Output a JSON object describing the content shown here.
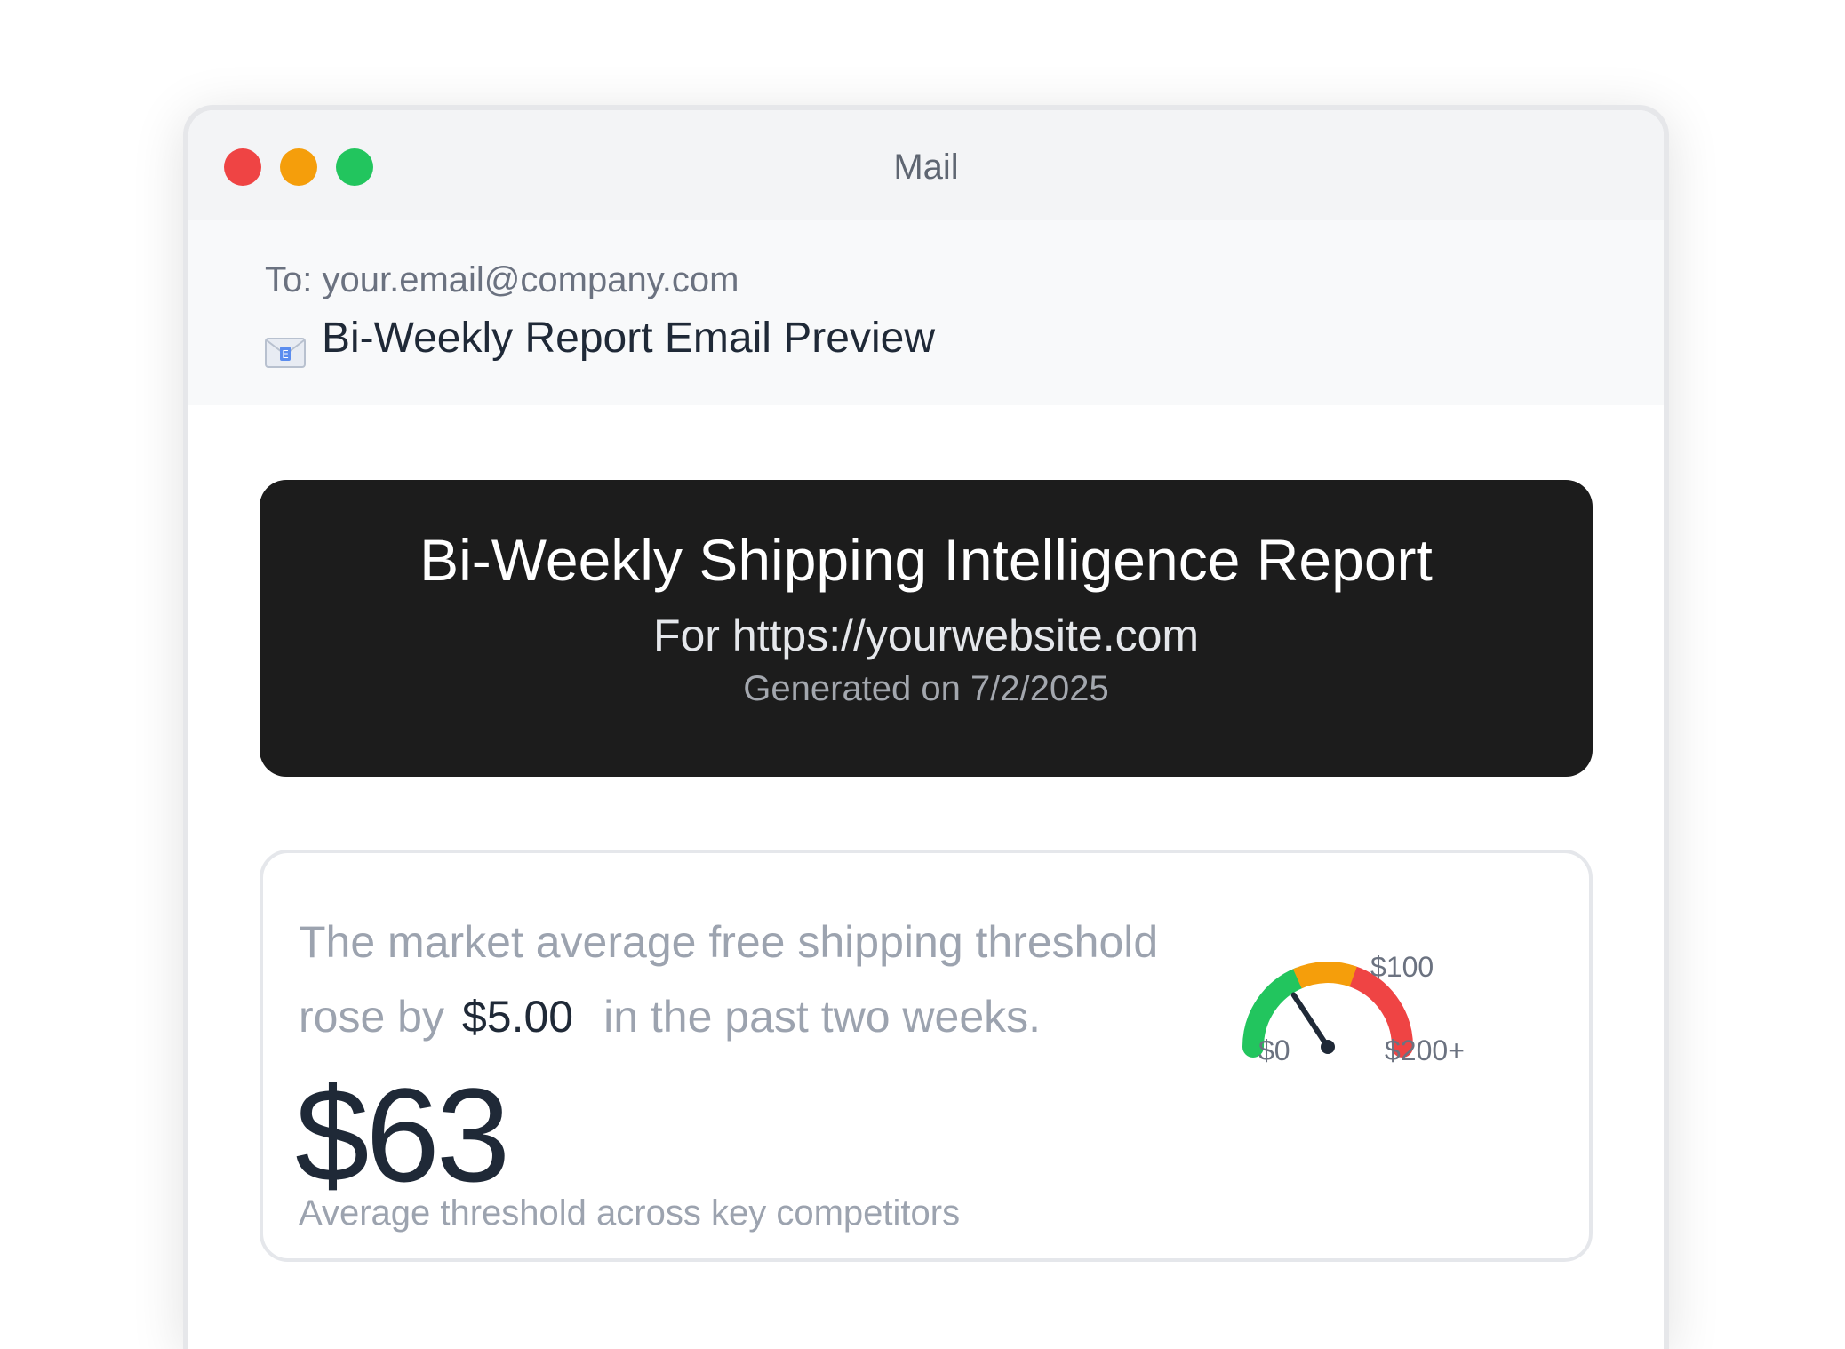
{
  "window": {
    "title": "Mail",
    "traffic_lights": [
      "#ef4444",
      "#f59e0b",
      "#22c55e"
    ]
  },
  "email": {
    "to": "To: your.email@company.com",
    "subject_icon": "envelope-icon",
    "subject": "Bi-Weekly Report Email Preview"
  },
  "banner": {
    "title": "Bi-Weekly Shipping Intelligence Report",
    "site": "For https://yourwebsite.com",
    "generated": "Generated on 7/2/2025"
  },
  "summary": {
    "text_start": "The market average free shipping threshold rose by",
    "delta": "$5.00",
    "text_end": "in the past two weeks.",
    "value": "$63",
    "caption": "Average threshold across key competitors"
  },
  "gauge": {
    "min_label": "$0",
    "mid_label": "$100",
    "max_label": "$200+",
    "value": 63,
    "max": 200,
    "colors": [
      "#22c55e",
      "#f59e0b",
      "#ef4444"
    ]
  }
}
